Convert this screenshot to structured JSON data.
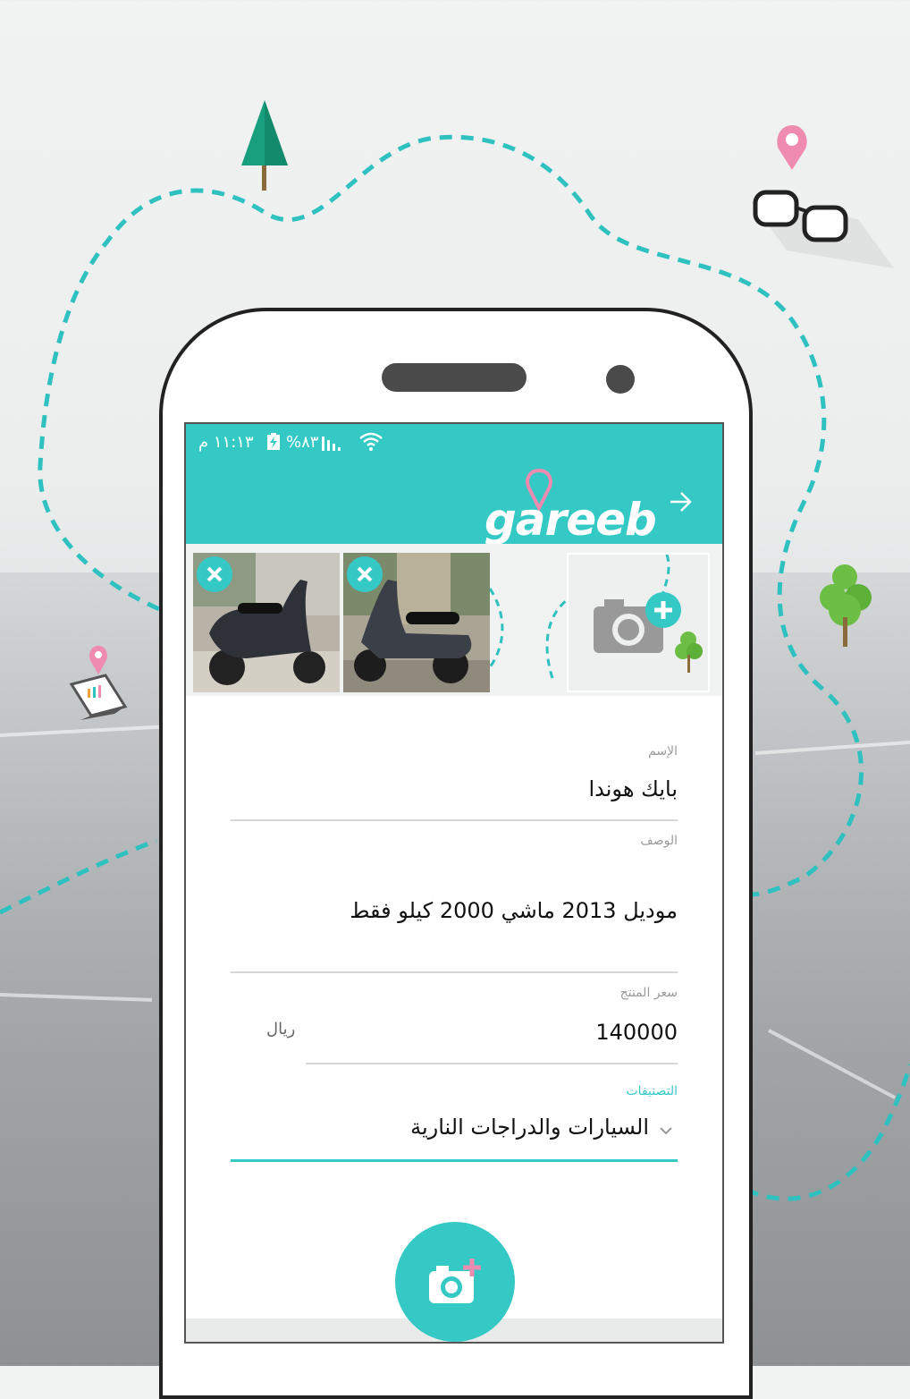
{
  "statusbar": {
    "time": "١١:١٣ م",
    "battery": "%٨٣"
  },
  "app": {
    "logo_text": "gareeb",
    "brand_color": "#35c9c6",
    "accent_pin_color": "#f08bb0"
  },
  "gallery": {
    "photos": [
      {
        "name": "scooter-photo-1"
      },
      {
        "name": "scooter-photo-2"
      }
    ]
  },
  "form": {
    "name_label": "الإسم",
    "name_value": "بايك هوندا",
    "description_label": "الوصف",
    "description_value": "موديل 2013 ماشي 2000 كيلو فقط",
    "price_label": "سعر المنتج",
    "price_value": "140000",
    "currency": "ريال",
    "category_label": "التصنيفات",
    "category_value": "السيارات والدراجات النارية"
  },
  "icons": [
    "back-arrow-icon",
    "remove-photo-icon",
    "add-photo-icon",
    "camera-add-icon",
    "chevron-down-icon",
    "map-pin-icon",
    "tree-icon",
    "glasses-icon",
    "laptop-icon"
  ]
}
